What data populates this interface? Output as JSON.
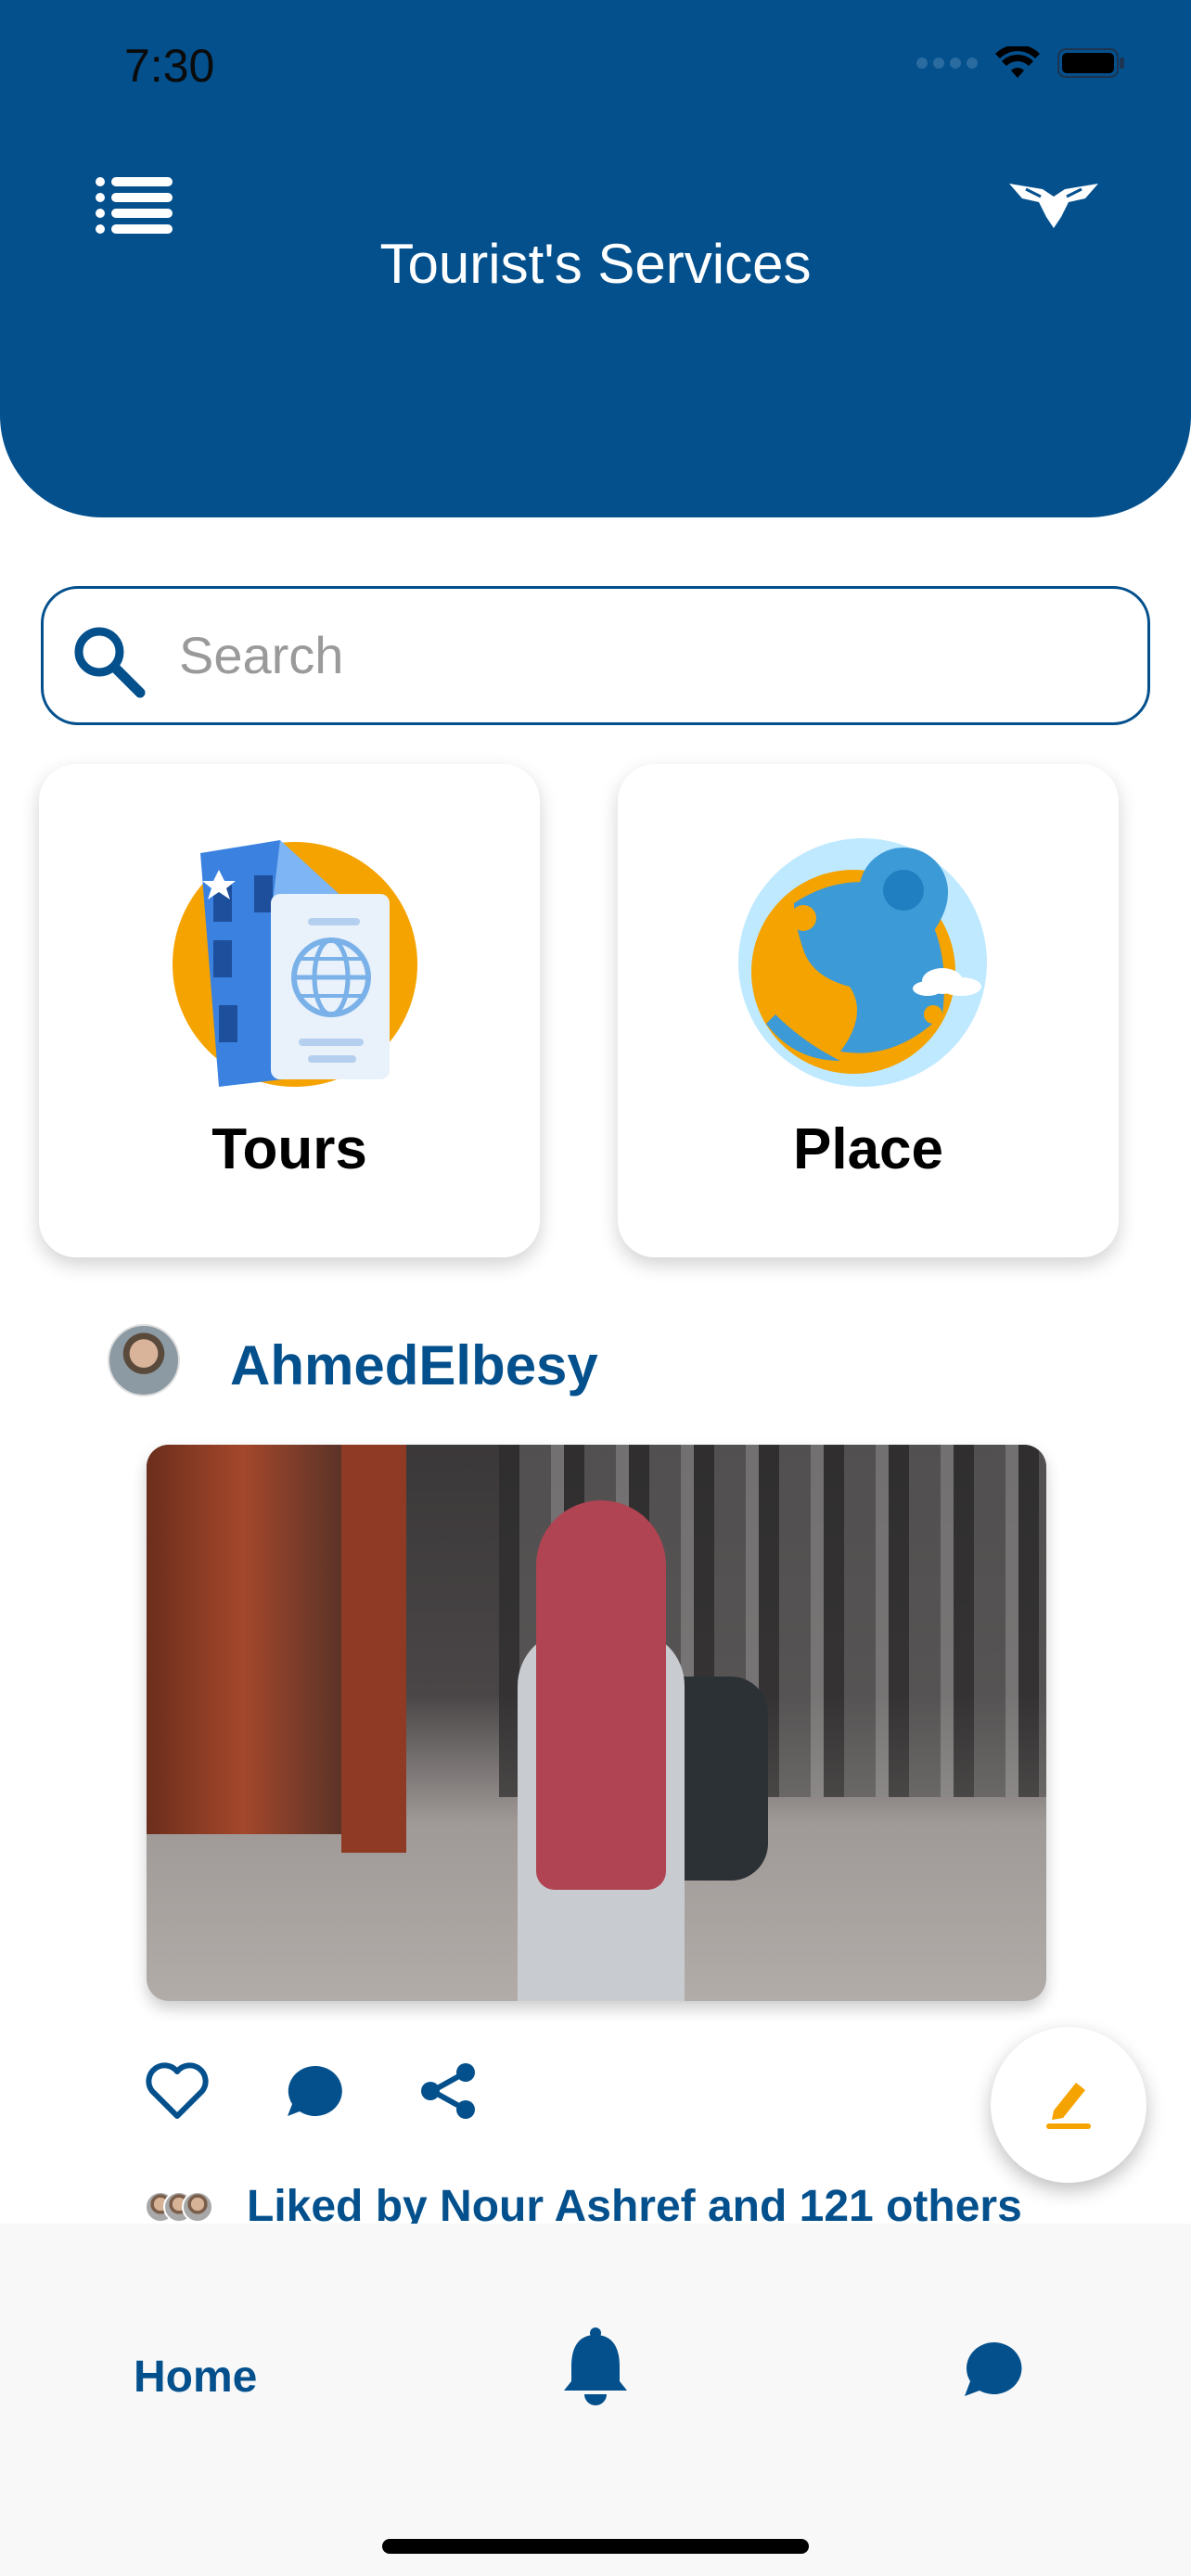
{
  "status_bar": {
    "time": "7:30"
  },
  "header": {
    "title": "Tourist's Services",
    "menu_icon": "menu-list-icon",
    "brand_icon": "winged-logo-icon"
  },
  "search": {
    "placeholder": "Search"
  },
  "categories": [
    {
      "label": "Tours",
      "icon": "passport-map-illustration"
    },
    {
      "label": "Place",
      "icon": "globe-pin-illustration"
    }
  ],
  "post": {
    "username": "AhmedElbesy",
    "liked_text": "Liked by Nour Ashref and 121 others"
  },
  "bottom_nav": {
    "home_label": "Home"
  },
  "colors": {
    "primary": "#03508d",
    "accent": "#f5a300",
    "background": "#ffffff"
  }
}
